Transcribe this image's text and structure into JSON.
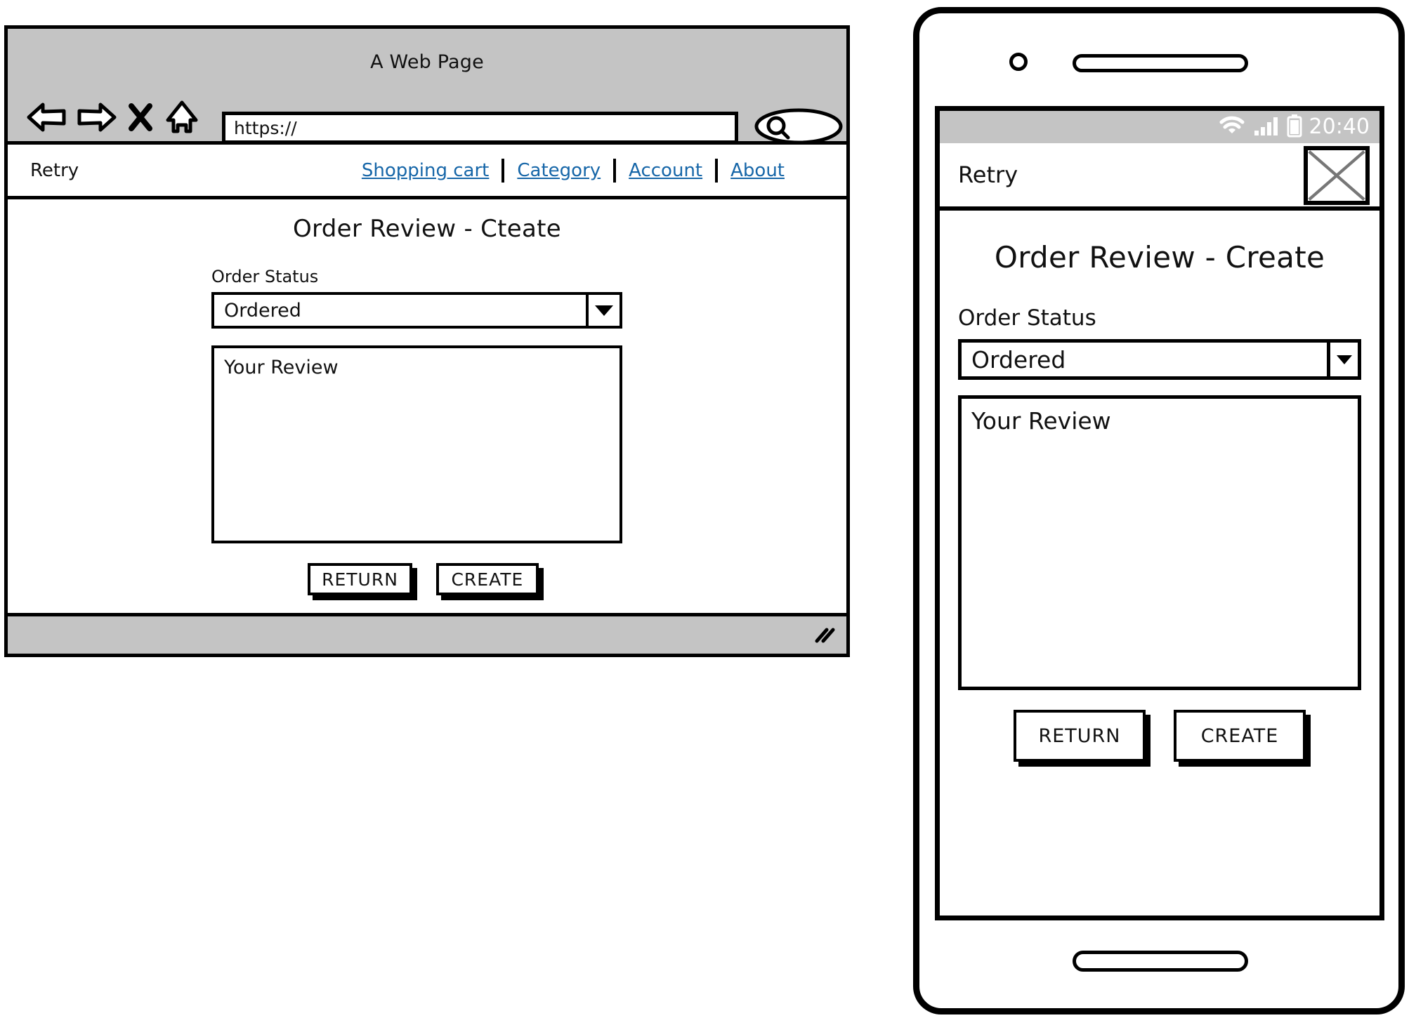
{
  "desktop": {
    "browser": {
      "window_title": "A Web Page",
      "url_value": "https://",
      "back_icon": "back-arrow-icon",
      "forward_icon": "forward-arrow-icon",
      "stop_icon": "close-x-icon",
      "home_icon": "home-icon",
      "search_icon": "search-magnifier-icon",
      "resize_icon": "resize-grip-icon"
    },
    "site_nav": {
      "brand": "Retry",
      "links": [
        {
          "label": "Shopping cart"
        },
        {
          "label": "Category"
        },
        {
          "label": "Account"
        },
        {
          "label": "About"
        }
      ],
      "link_color": "#1666a8"
    },
    "page": {
      "title": "Order Review - Cteate",
      "order_status_label": "Order Status",
      "order_status_value": "Ordered",
      "review_placeholder": "Your Review",
      "dropdown_icon": "chevron-down-icon",
      "buttons": {
        "return_label": "RETURN",
        "create_label": "CREATE"
      }
    }
  },
  "mobile": {
    "status_bar": {
      "wifi_icon": "wifi-icon",
      "signal_icon": "signal-bars-icon",
      "battery_icon": "battery-icon",
      "time": "20:40",
      "bar_color": "#c4c4c4"
    },
    "header": {
      "brand": "Retry",
      "menu_icon": "image-placeholder-x-icon"
    },
    "page": {
      "title": "Order Review - Create",
      "order_status_label": "Order Status",
      "order_status_value": "Ordered",
      "review_placeholder": "Your Review",
      "dropdown_icon": "chevron-down-icon",
      "buttons": {
        "return_label": "RETURN",
        "create_label": "CREATE"
      }
    }
  }
}
